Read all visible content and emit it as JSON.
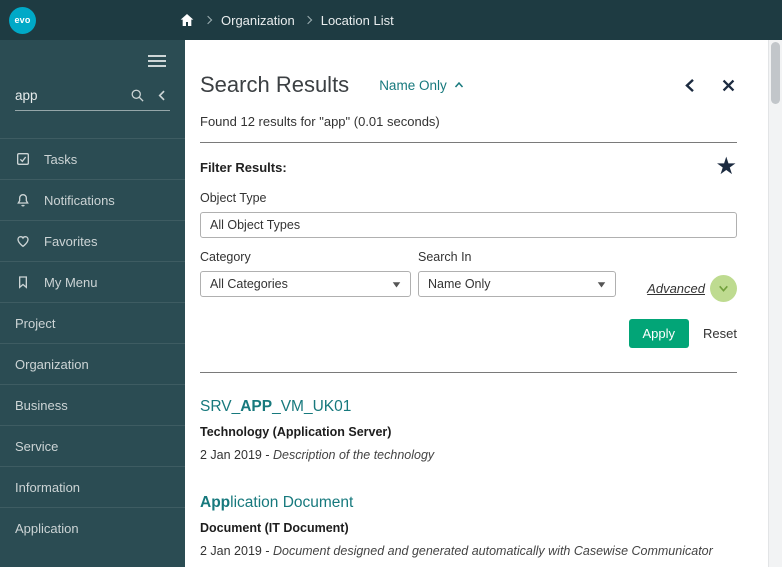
{
  "topbar": {
    "logo_text": "evo",
    "breadcrumb": [
      "Organization",
      "Location List"
    ]
  },
  "sidebar": {
    "search_value": "app",
    "menu_items": [
      {
        "label": "Tasks",
        "icon": "tasks-icon"
      },
      {
        "label": "Notifications",
        "icon": "bell-icon"
      },
      {
        "label": "Favorites",
        "icon": "heart-icon"
      },
      {
        "label": "My Menu",
        "icon": "bookmark-icon"
      },
      {
        "label": "Project",
        "icon": ""
      },
      {
        "label": "Organization",
        "icon": ""
      },
      {
        "label": "Business",
        "icon": ""
      },
      {
        "label": "Service",
        "icon": ""
      },
      {
        "label": "Information",
        "icon": ""
      },
      {
        "label": "Application",
        "icon": ""
      }
    ]
  },
  "main": {
    "title": "Search Results",
    "mode_link": "Name Only",
    "summary": "Found 12 results for \"app\" (0.01 seconds)",
    "filter": {
      "heading": "Filter Results:",
      "object_type_label": "Object Type",
      "object_type_value": "All Object Types",
      "category_label": "Category",
      "category_value": "All Categories",
      "search_in_label": "Search In",
      "search_in_value": "Name Only",
      "advanced_label": "Advanced",
      "apply_label": "Apply",
      "reset_label": "Reset"
    },
    "results": [
      {
        "title_pre": "SRV_",
        "title_bold": "APP",
        "title_post": "_VM_UK01",
        "subtitle": "Technology (Application Server)",
        "date": "2 Jan 2019 - ",
        "description": "Description of the technology"
      },
      {
        "title_pre": "",
        "title_bold": "App",
        "title_post": "lication Document",
        "subtitle": "Document (IT Document)",
        "date": "2 Jan 2019 - ",
        "description": "Document designed and generated automatically with Casewise Communicator"
      }
    ]
  },
  "colors": {
    "topbar_bg": "#1e3b42",
    "sidebar_bg": "#2b4c53",
    "logo_bg": "#00a9c7",
    "accent_teal": "#17797d",
    "apply_green": "#02a577",
    "advanced_circle_bg": "#bedb90",
    "advanced_chevron": "#71a03c",
    "icon_dark": "#1c2b40"
  }
}
